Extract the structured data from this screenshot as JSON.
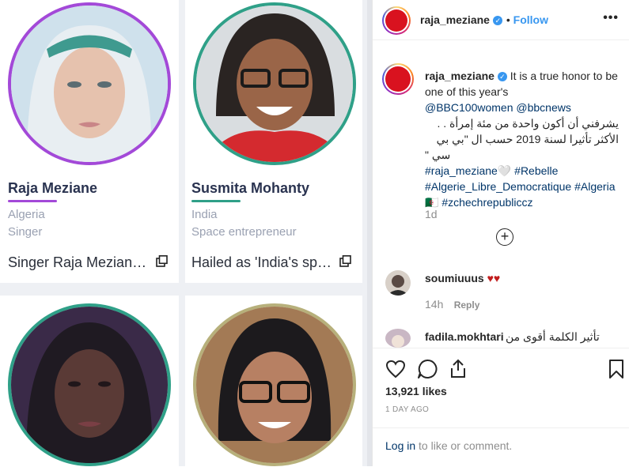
{
  "cards": [
    {
      "name": "Raja Meziane",
      "country": "Algeria",
      "role": "Singer",
      "blurb": "Singer Raja Mezian…",
      "accent": "#a349d8"
    },
    {
      "name": "Susmita Mohanty",
      "country": "India",
      "role": "Space entrepreneur",
      "blurb": "Hailed as 'India's sp…",
      "accent": "#2fa088"
    },
    {
      "accent": "#2fa088"
    },
    {
      "accent": "#b7b07b"
    }
  ],
  "post": {
    "username": "raja_meziane",
    "follow_label": "Follow",
    "more_label": "•••",
    "caption_text": "It is a true honor to be one of this year's",
    "caption_mentions": "@BBC100women @bbcnews",
    "caption_arabic_1": "يشرفني أن أكون واحدة من مئة إمرأة . .",
    "caption_arabic_2": "الأكثر تأثيرا لسنة 2019 حسب ال \"بي بي",
    "caption_arabic_3": "سي \"",
    "caption_tags_1": "#raja_meziane🤍 #Rebelle",
    "caption_tags_2": "#Algerie_Libre_Democratique #Algeria",
    "caption_tags_3": "🇩🇿 #zchechrepublicсz",
    "time": "1d",
    "load_more": "+",
    "comments": [
      {
        "user": "soumiuuus",
        "text": "♥♥",
        "time": "14h",
        "reply": "Reply"
      },
      {
        "user": "fadila.mokhtari",
        "text": "تأثير الكلمة أقوى من"
      }
    ],
    "likes": "13,921 likes",
    "date": "1 DAY AGO",
    "login_link": "Log in",
    "login_rest": " to like or comment."
  },
  "icons": [
    "external-link-icon",
    "verified-badge-icon",
    "more-options-icon",
    "heart-icon",
    "comment-icon",
    "share-icon",
    "bookmark-icon",
    "plus-circle-icon"
  ]
}
